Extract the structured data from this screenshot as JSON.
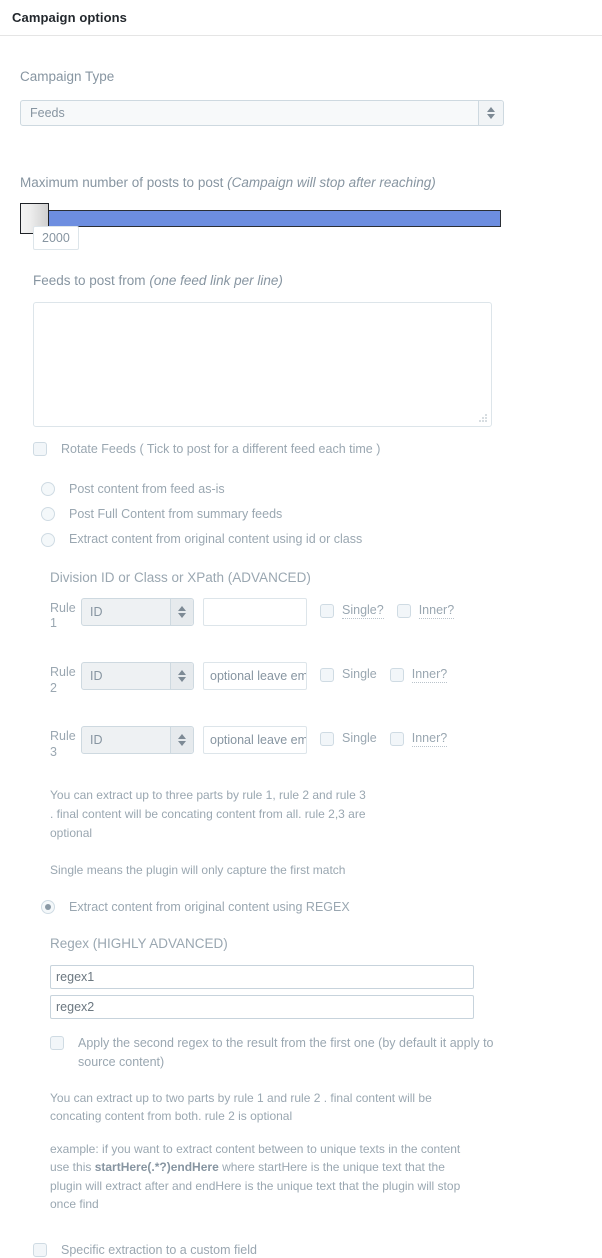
{
  "header": {
    "title": "Campaign options"
  },
  "campaign_type": {
    "label": "Campaign Type",
    "selected": "Feeds"
  },
  "max_posts": {
    "label": "Maximum number of posts to post",
    "label_em": "(Campaign will stop after reaching)",
    "value": "2000"
  },
  "feeds": {
    "label": "Feeds to post from",
    "label_em": "(one feed link per line)",
    "textarea_value": "",
    "rotate_label": "Rotate Feeds ( Tick to post for a different feed each time )"
  },
  "content_modes": [
    {
      "label": "Post content from feed as-is",
      "checked": false
    },
    {
      "label": "Post Full Content from summary feeds",
      "checked": false
    },
    {
      "label": "Extract content from original content using id or class",
      "checked": false
    }
  ],
  "division": {
    "heading": "Division ID or Class or XPath (ADVANCED)",
    "rules": [
      {
        "tag_line1": "Rule",
        "tag_line2": "1",
        "select_value": "ID",
        "input_value": "",
        "input_placeholder": "",
        "single_label": "Single?",
        "single_dotted": true,
        "inner_label": "Inner?",
        "inner_dotted": true
      },
      {
        "tag_line1": "Rule",
        "tag_line2": "2",
        "select_value": "ID",
        "input_value": "",
        "input_placeholder": "optional leave empty",
        "single_label": "Single",
        "single_dotted": false,
        "inner_label": "Inner?",
        "inner_dotted": true
      },
      {
        "tag_line1": "Rule",
        "tag_line2": "3",
        "select_value": "ID",
        "input_value": "",
        "input_placeholder": "optional leave empty",
        "single_label": "Single",
        "single_dotted": false,
        "inner_label": "Inner?",
        "inner_dotted": true
      }
    ],
    "help_1": "You can extract up to three parts by rule 1, rule 2 and rule 3 . final content will be concating content from all. rule 2,3 are optional",
    "help_2": "Single means the plugin will only capture the first match"
  },
  "regex_mode": {
    "label": "Extract content from original content using REGEX",
    "checked": true
  },
  "regex": {
    "heading": "Regex (HIGHLY ADVANCED)",
    "input1_placeholder": "regex1",
    "input1_value": "",
    "input2_placeholder": "regex2",
    "input2_value": "",
    "apply_second_label": "Apply the second regex to the result from the first one (by default it apply to source content)",
    "help_1": "You can extract up to two parts by rule 1 and rule 2 . final content will be concating content from both. rule 2 is optional",
    "help_example_pre": "example: if you want to extract content between to unique texts in the content use this ",
    "help_example_bold": "startHere(.*?)endHere",
    "help_example_post": " where startHere is the unique text that the plugin will extract after and endHere is the unique text that the plugin will stop once find"
  },
  "custom_field": {
    "label": "Specific extraction to a custom field"
  },
  "colors": {
    "slider_fill": "#6d8ee0",
    "title": "#23282d",
    "muted": "#9aa7b1"
  }
}
